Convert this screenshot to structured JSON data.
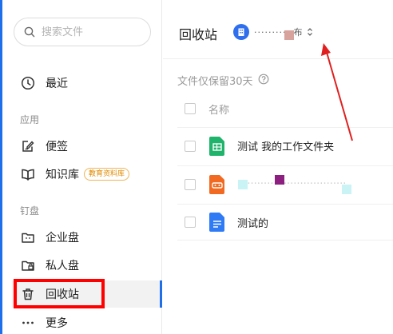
{
  "search": {
    "placeholder": "搜索文件"
  },
  "sidebar": {
    "recent": "最近",
    "section_apps": "应用",
    "notes": "便签",
    "knowledge": "知识库",
    "knowledge_badge": "教育资料库",
    "section_ding": "钉盘",
    "enterprise": "企业盘",
    "personal": "私人盘",
    "recycle": "回收站",
    "more": "更多"
  },
  "header": {
    "title": "回收站",
    "org_name": "·········· 布"
  },
  "note": "文件仅保留30天",
  "list": {
    "column_name": "名称",
    "rows": [
      {
        "name": "测试 我的工作文件夹",
        "icon": "spreadsheet-icon"
      },
      {
        "name": "·································",
        "icon": "mindmap-icon"
      },
      {
        "name": "测试的",
        "icon": "document-icon"
      }
    ]
  },
  "colors": {
    "accent": "#1f6feb",
    "highlight": "#ff0000",
    "badge": "#e08a00"
  }
}
